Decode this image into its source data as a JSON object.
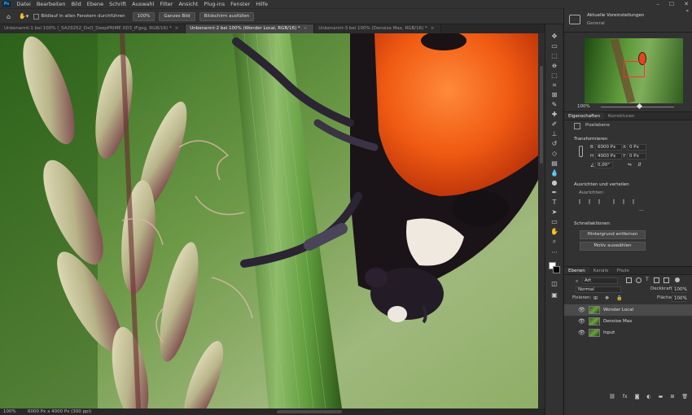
{
  "menubar": {
    "logo": "Ps",
    "items": [
      "Datei",
      "Bearbeiten",
      "Bild",
      "Ebene",
      "Schrift",
      "Auswahl",
      "Filter",
      "Ansicht",
      "Plug-ins",
      "Fenster",
      "Hilfe"
    ],
    "win_min": "–",
    "win_max": "☐",
    "win_close": "✕"
  },
  "options": {
    "scroll_all": "Bildlauf in allen Fenstern durchführen",
    "zoom100": "100%",
    "fit": "Ganzes Bild",
    "fill": "Bildschirm ausfüllen"
  },
  "tabs": [
    {
      "label": "Unbenannt-1 bei 100% (_SA29252_DxO_DeepPRIME XD3_iFgog, RGB/16) *",
      "active": false
    },
    {
      "label": "Unbenannt-2 bei 100% (Wonder Local, RGB/16) *",
      "active": true
    },
    {
      "label": "Unbenannt-3 bei 100% (Denoise Max, RGB/16) *",
      "active": false
    }
  ],
  "tab_close": "×",
  "status": {
    "zoom": "100%",
    "doc_info": "6000 Px x 4000 Px (300 ppi)"
  },
  "navigator": {
    "title": "Aktuelle Voreinstellungen",
    "subtitle": "General",
    "zoom": "100%"
  },
  "properties": {
    "tab_props": "Eigenschaften",
    "tab_adjust": "Korrekturen",
    "kind": "Pixelebene",
    "transform": "Transformieren",
    "w_label": "B",
    "w_value": "6000 Px",
    "h_label": "H",
    "h_value": "4000 Px",
    "x_label": "X",
    "x_value": "0 Px",
    "y_label": "Y",
    "y_value": "0 Px",
    "angle": "0,00°",
    "align_section": "Ausrichten und verteilen",
    "align_label": "Ausrichten:",
    "quick_section": "Schnellaktionen",
    "btn_remove_bg": "Hintergrund entfernen",
    "btn_select_subject": "Motiv auswählen"
  },
  "layers_panel": {
    "tab_layers": "Ebenen",
    "tab_channels": "Kanäle",
    "tab_paths": "Pfade",
    "filter": "Art",
    "blend": "Normal",
    "opacity_label": "Deckkraft:",
    "opacity": "100%",
    "lock_label": "Fixieren:",
    "fill_label": "Fläche:",
    "fill": "100%",
    "layers": [
      {
        "name": "Wonder Local",
        "selected": true
      },
      {
        "name": "Denoise Max",
        "selected": false
      },
      {
        "name": "Input",
        "selected": false
      }
    ]
  },
  "colors": {
    "accent": "#31a8ff",
    "ladybug": "#e8451a",
    "stem": "#5f9a3c",
    "background": "#8fb070"
  }
}
